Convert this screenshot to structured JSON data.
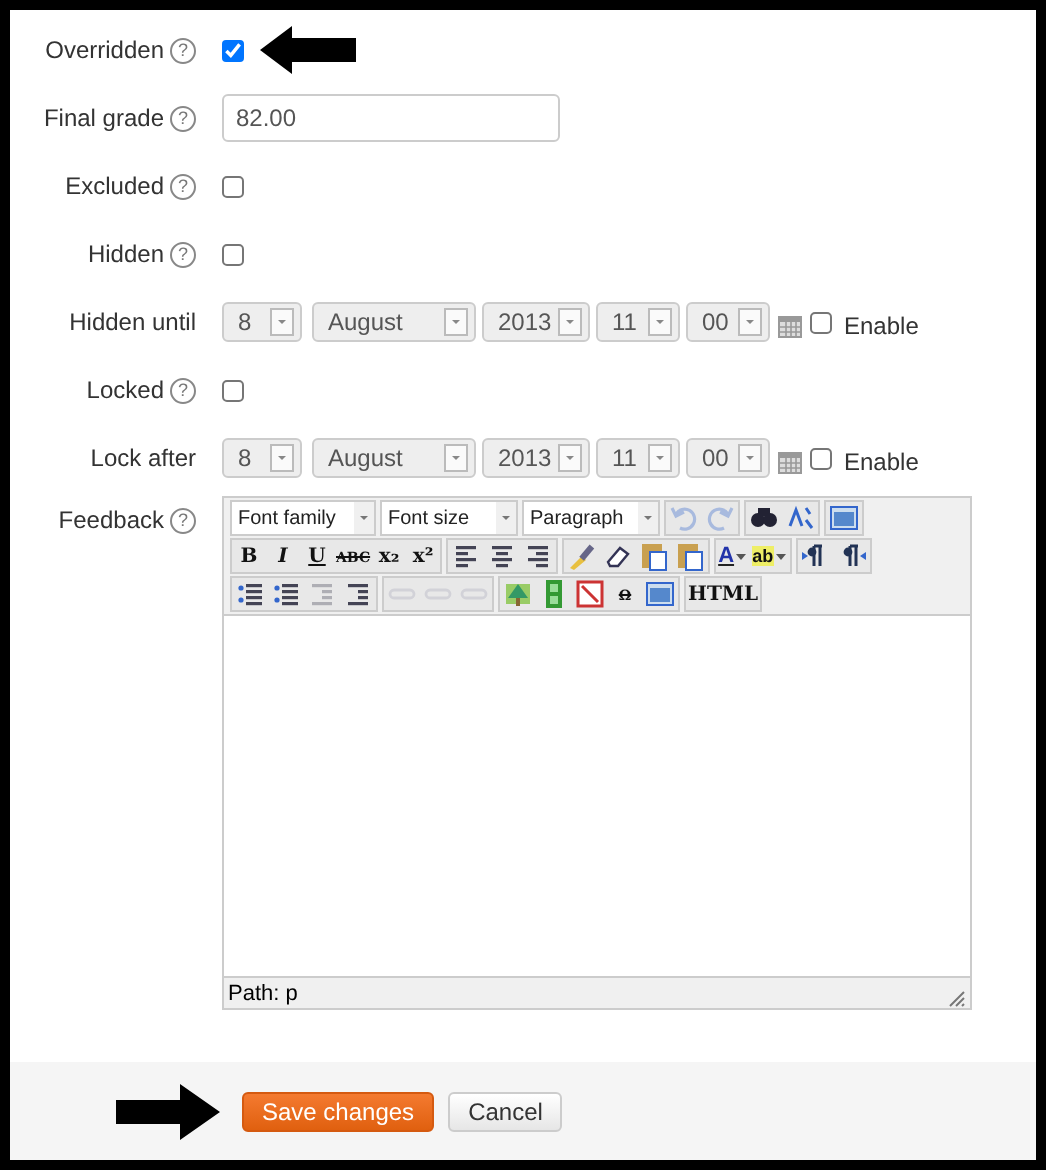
{
  "fields": [
    {
      "kind": "checkbox",
      "label": "Overridden",
      "help": "?",
      "checked": true
    },
    {
      "kind": "text",
      "label": "Final grade",
      "help": "?",
      "value": "82.00"
    },
    {
      "kind": "checkbox",
      "label": "Excluded",
      "help": "?",
      "checked": false
    },
    {
      "kind": "checkbox",
      "label": "Hidden",
      "help": "?",
      "checked": false
    },
    {
      "kind": "datetime",
      "label": "Hidden until",
      "selects": [
        "8",
        "August",
        "2013",
        "11",
        "00"
      ],
      "enable": {
        "label": "Enable",
        "checked": false
      }
    },
    {
      "kind": "checkbox",
      "label": "Locked",
      "help": "?",
      "checked": false
    },
    {
      "kind": "datetime",
      "label": "Lock after",
      "selects": [
        "8",
        "August",
        "2013",
        "11",
        "00"
      ],
      "enable": {
        "label": "Enable",
        "checked": false
      }
    },
    {
      "kind": "editor",
      "label": "Feedback",
      "help": "?",
      "path": "Path: p",
      "toolbar": [
        [
          {
            "kind": "dropdown",
            "label": "Font family"
          },
          {
            "kind": "dropdown",
            "label": "Font size"
          },
          {
            "kind": "dropdown",
            "label": "Paragraph"
          },
          {
            "kind": "group",
            "items": [
              {
                "kind": "icon",
                "disabled": true
              },
              {
                "kind": "icon",
                "disabled": true
              }
            ]
          },
          {
            "kind": "group",
            "items": [
              {
                "kind": "icon",
                "disabled": false
              },
              {
                "kind": "icon",
                "disabled": false
              }
            ]
          },
          {
            "kind": "group",
            "items": [
              {
                "kind": "icon",
                "disabled": false
              }
            ]
          }
        ],
        [
          {
            "kind": "group",
            "items": [
              {
                "kind": "glyph",
                "label": "B",
                "disabled": false
              },
              {
                "kind": "glyph",
                "label": "I",
                "disabled": false
              },
              {
                "kind": "glyph",
                "label": "U",
                "disabled": false
              },
              {
                "kind": "glyph",
                "label": "ABC",
                "disabled": false
              },
              {
                "kind": "glyph",
                "label": "x₂",
                "disabled": false
              },
              {
                "kind": "glyph",
                "label": "x²",
                "disabled": false
              }
            ]
          },
          {
            "kind": "group",
            "items": [
              {
                "kind": "icon",
                "disabled": false
              },
              {
                "kind": "icon",
                "disabled": false
              },
              {
                "kind": "icon",
                "disabled": false
              }
            ]
          },
          {
            "kind": "group",
            "items": [
              {
                "kind": "icon",
                "disabled": false
              },
              {
                "kind": "icon",
                "disabled": false
              },
              {
                "kind": "icon",
                "disabled": false
              },
              {
                "kind": "icon",
                "disabled": false
              }
            ]
          },
          {
            "kind": "group",
            "items": [
              {
                "kind": "split",
                "label": "A",
                "disabled": false
              },
              {
                "kind": "split",
                "label": "ab",
                "disabled": false
              }
            ]
          },
          {
            "kind": "group",
            "items": [
              {
                "kind": "icon",
                "disabled": false
              },
              {
                "kind": "icon",
                "disabled": false
              }
            ]
          }
        ],
        [
          {
            "kind": "group",
            "items": [
              {
                "kind": "icon",
                "disabled": false
              },
              {
                "kind": "icon",
                "disabled": false
              },
              {
                "kind": "icon",
                "disabled": true
              },
              {
                "kind": "icon",
                "disabled": false
              }
            ]
          },
          {
            "kind": "group",
            "items": [
              {
                "kind": "icon",
                "disabled": true
              },
              {
                "kind": "icon",
                "disabled": true
              },
              {
                "kind": "icon",
                "disabled": true
              }
            ]
          },
          {
            "kind": "group",
            "items": [
              {
                "kind": "icon",
                "disabled": false
              },
              {
                "kind": "icon",
                "disabled": false
              },
              {
                "kind": "icon",
                "disabled": false
              },
              {
                "kind": "glyph",
                "label": "Ω",
                "disabled": false
              },
              {
                "kind": "icon",
                "disabled": false
              }
            ]
          },
          {
            "kind": "group",
            "items": [
              {
                "kind": "glyph",
                "label": "HTML",
                "disabled": false
              }
            ]
          }
        ]
      ]
    }
  ],
  "buttons": [
    {
      "kind": "primary",
      "label": "Save changes"
    },
    {
      "kind": "secondary",
      "label": "Cancel"
    }
  ]
}
